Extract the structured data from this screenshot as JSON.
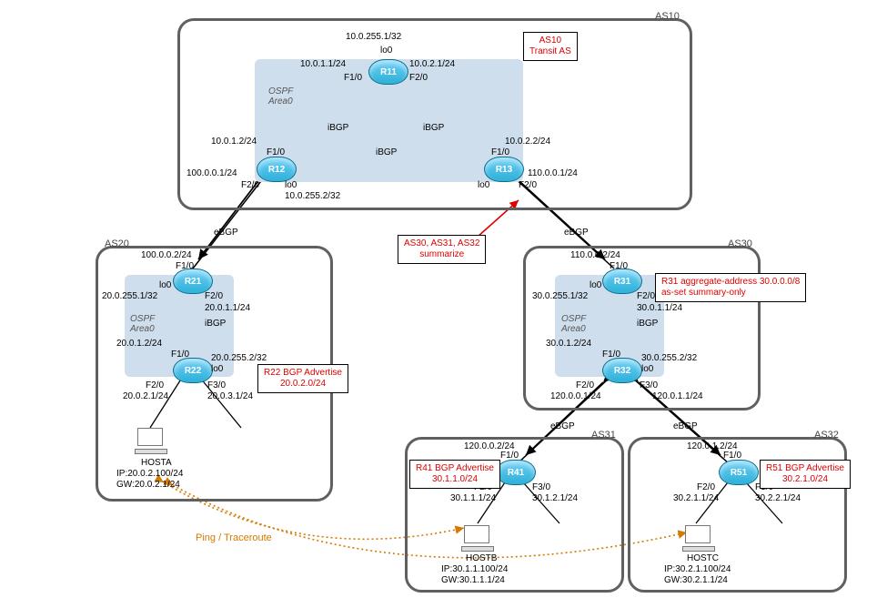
{
  "as": {
    "as10": "AS10",
    "as20": "AS20",
    "as30": "AS30",
    "as31": "AS31",
    "as32": "AS32"
  },
  "ospf": {
    "label": "OSPF\nArea0"
  },
  "routers": {
    "r11": "R11",
    "r12": "R12",
    "r13": "R13",
    "r21": "R21",
    "r22": "R22",
    "r31": "R31",
    "r32": "R32",
    "r41": "R41",
    "r51": "R51"
  },
  "hosts": {
    "a": {
      "name": "HOSTA",
      "ip": "IP:20.0.2.100/24",
      "gw": "GW:20.0.2.1/24"
    },
    "b": {
      "name": "HOSTB",
      "ip": "IP:30.1.1.100/24",
      "gw": "GW:30.1.1.1/24"
    },
    "c": {
      "name": "HOSTC",
      "ip": "IP:30.2.1.100/24",
      "gw": "GW:30.2.1.1/24"
    }
  },
  "bgp": {
    "ibgp": "iBGP",
    "ebgp": "eBGP"
  },
  "anno": {
    "as10": "AS10\nTransit AS",
    "summ": "AS30, AS31, AS32\nsummarize",
    "r31": "R31 aggregate-address 30.0.0.0/8\nas-set summary-only",
    "r22": "R22 BGP Advertise\n20.0.2.0/24",
    "r41": "R41 BGP Advertise\n30.1.1.0/24",
    "r51": "R51 BGP Advertise\n30.2.1.0/24"
  },
  "ping": "Ping / Traceroute",
  "if": {
    "r11_lo0": "10.0.255.1/32",
    "lo0": "lo0",
    "r11_f10": "10.0.1.1/24",
    "r11_f20": "10.0.2.1/24",
    "f10": "F1/0",
    "f20": "F2/0",
    "f30": "F3/0",
    "r12_f10": "10.0.1.2/24",
    "r12_f20": "100.0.0.1/24",
    "r12_lo0": "10.0.255.2/32",
    "r13_f10": "10.0.2.2/24",
    "r13_f20": "110.0.0.1/24",
    "r21_f10": "100.0.0.2/24",
    "r21_f20": "20.0.1.1/24",
    "r21_lo0": "20.0.255.1/32",
    "r22_f10": "20.0.1.2/24",
    "r22_f20": "20.0.2.1/24",
    "r22_f30": "20.0.3.1/24",
    "r22_lo0": "20.0.255.2/32",
    "r31_f10": "110.0.0.2/24",
    "r31_f20": "30.0.1.1/24",
    "r31_lo0": "30.0.255.1/32",
    "r32_f10": "30.0.1.2/24",
    "r32_f20": "120.0.0.1/24",
    "r32_f30": "120.0.1.1/24",
    "r32_lo0": "30.0.255.2/32",
    "r41_f10": "120.0.0.2/24",
    "r41_f20": "30.1.1.1/24",
    "r41_f30": "30.1.2.1/24",
    "r51_f10": "120.0.1.2/24",
    "r51_f20": "30.2.1.1/24",
    "r51_f30": "30.2.2.1/24"
  }
}
